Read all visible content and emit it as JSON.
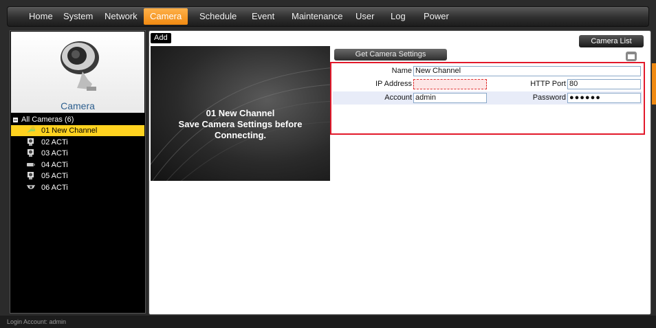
{
  "nav": {
    "items": [
      {
        "label": "Home"
      },
      {
        "label": "System"
      },
      {
        "label": "Network"
      },
      {
        "label": "Camera"
      },
      {
        "label": "Schedule"
      },
      {
        "label": "Event"
      },
      {
        "label": "Maintenance"
      },
      {
        "label": "User"
      },
      {
        "label": "Log"
      },
      {
        "label": "Power"
      }
    ],
    "active": "Camera",
    "active_color": "#f08a12"
  },
  "sidebar": {
    "title": "Camera",
    "tree_root": "All Cameras (6)",
    "cameras": [
      {
        "label": "01  New Channel",
        "icon": "new-camera-icon"
      },
      {
        "label": "02  ACTi",
        "icon": "box-camera-icon"
      },
      {
        "label": "03  ACTi",
        "icon": "box-camera-icon"
      },
      {
        "label": "04  ACTi",
        "icon": "bullet-camera-icon"
      },
      {
        "label": "05  ACTi",
        "icon": "box-camera-icon"
      },
      {
        "label": "06  ACTi",
        "icon": "dome-camera-icon"
      }
    ],
    "selected": "01  New Channel",
    "selected_color": "#ffd21f"
  },
  "main": {
    "tab_label": "Add",
    "camera_list_label": "Camera List",
    "preview": {
      "line1": "01 New Channel",
      "line2": "Save Camera Settings before",
      "line3": "Connecting."
    },
    "get_settings_label": "Get Camera Settings",
    "form": {
      "name_label": "Name",
      "name_value": "New Channel",
      "ip_label": "IP Address",
      "ip_value": "",
      "http_port_label": "HTTP Port",
      "http_port_value": "80",
      "account_label": "Account",
      "account_value": "admin",
      "password_label": "Password",
      "password_value": "●●●●●●"
    },
    "highlight_color": "#e2182a"
  },
  "status": {
    "login": "Login Account: admin"
  }
}
